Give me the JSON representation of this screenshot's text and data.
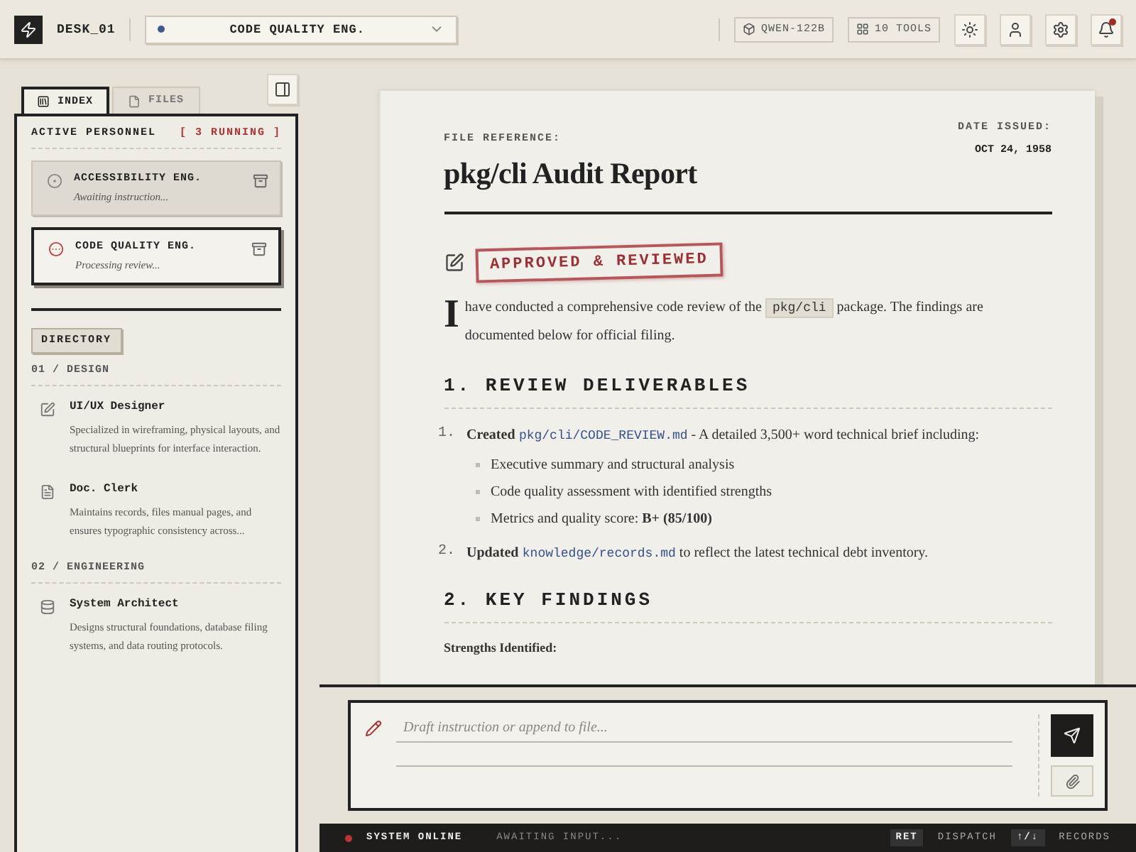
{
  "header": {
    "workspace": "DESK_01",
    "agent_select": {
      "value": "CODE QUALITY ENG.",
      "color": "#3d5a8c"
    },
    "model_badge": "QWEN-122B",
    "tools_badge": "10 TOOLS",
    "notifications": {
      "unread": true
    }
  },
  "sidebar": {
    "tabs": [
      {
        "label": "INDEX",
        "selected": true
      },
      {
        "label": "FILES",
        "selected": false
      }
    ],
    "active_heading": "ACTIVE PERSONNEL",
    "running_count": "[ 3 RUNNING ]",
    "agents": [
      {
        "name": "ACCESSIBILITY ENG.",
        "status": "Awaiting instruction...",
        "selected": false,
        "busy": false
      },
      {
        "name": "CODE QUALITY ENG.",
        "status": "Processing review...",
        "selected": true,
        "busy": true
      }
    ],
    "directory_label": "DIRECTORY",
    "groups": [
      {
        "title": "01 / DESIGN",
        "items": [
          {
            "kind": "pencil",
            "name": "UI/UX Designer",
            "description": "Specialized in wireframing, physical layouts, and structural blueprints for interface interaction."
          },
          {
            "kind": "document",
            "name": "Doc. Clerk",
            "description": "Maintains records, files manual pages, and ensures typographic consistency across..."
          }
        ]
      },
      {
        "title": "02 / ENGINEERING",
        "items": [
          {
            "kind": "database",
            "name": "System Architect",
            "description": "Designs structural foundations, database filing systems, and data routing protocols."
          }
        ]
      }
    ]
  },
  "document": {
    "file_ref_label": "FILE REFERENCE:",
    "title": "pkg/cli Audit Report",
    "date_label": "DATE ISSUED:",
    "date": "OCT 24, 1958",
    "stamp": "APPROVED & REVIEWED",
    "intro": {
      "drop_cap": "I",
      "parts": [
        {
          "kind": "text",
          "text": "have conducted a comprehensive code review of the "
        },
        {
          "kind": "code",
          "text": "pkg/cli"
        },
        {
          "kind": "text",
          "text": " package. The findings are documented below for official filing."
        }
      ]
    },
    "sections": [
      {
        "heading": "1. REVIEW DELIVERABLES",
        "items": [
          {
            "number": "1.",
            "parts": [
              {
                "kind": "bold",
                "text": "Created"
              },
              {
                "kind": "path",
                "text": "pkg/cli/CODE_REVIEW.md"
              },
              {
                "kind": "text",
                "text": " - A detailed 3,500+ word technical brief including:"
              }
            ],
            "children": [
              {
                "text": "Executive summary and structural analysis"
              },
              {
                "text": "Code quality assessment with identified strengths"
              },
              {
                "text": "Metrics and quality score: **B+ (85/100)**"
              }
            ]
          },
          {
            "number": "2.",
            "parts": [
              {
                "kind": "bold",
                "text": "Updated"
              },
              {
                "kind": "path",
                "text": "knowledge/records.md"
              },
              {
                "kind": "text",
                "text": " to reflect the latest technical debt inventory."
              }
            ]
          }
        ]
      },
      {
        "heading": "2. KEY FINDINGS",
        "subheading": "Strengths Identified:"
      }
    ]
  },
  "composer": {
    "placeholder": "Draft instruction or append to file..."
  },
  "status_bar": {
    "status": "SYSTEM ONLINE",
    "online": true,
    "message": "AWAITING INPUT...",
    "shortcuts": [
      {
        "key": "RET",
        "label": "DISPATCH"
      },
      {
        "key": "↑/↓",
        "label": "RECORDS"
      }
    ]
  }
}
